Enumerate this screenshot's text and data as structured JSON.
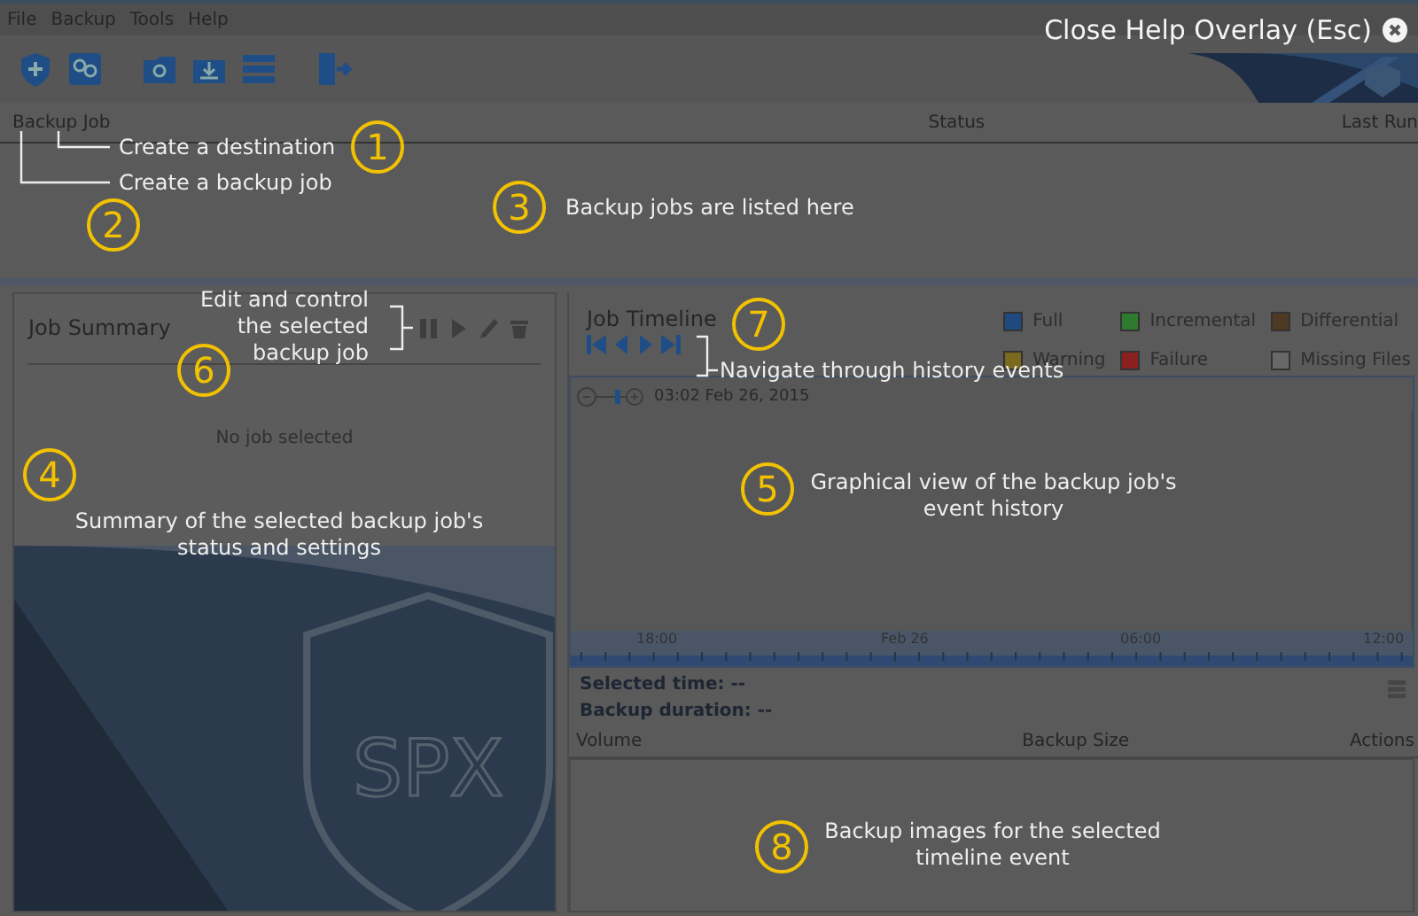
{
  "menu": [
    "File",
    "Backup",
    "Tools",
    "Help"
  ],
  "close_overlay": {
    "label": "Close Help Overlay (Esc)"
  },
  "jobs_table": {
    "columns": [
      "Backup Job",
      "Status",
      "Last Run"
    ]
  },
  "job_summary": {
    "title": "Job Summary",
    "empty_text": "No job selected",
    "logo_text": "SPX"
  },
  "job_timeline": {
    "title": "Job Timeline",
    "legend": [
      {
        "label": "Full",
        "color": "#1e4a80"
      },
      {
        "label": "Incremental",
        "color": "#2e7a2e"
      },
      {
        "label": "Differential",
        "color": "#4e3a22"
      },
      {
        "label": "Warning",
        "color": "#7a6a20"
      },
      {
        "label": "Failure",
        "color": "#8a2020"
      },
      {
        "label": "Missing Files",
        "color": "#686868"
      }
    ],
    "current_time": "03:02 Feb 26, 2015",
    "axis_labels": [
      "18:00",
      "Feb 26",
      "06:00",
      "12:00"
    ]
  },
  "details": [
    "Selected time: --",
    "Backup duration: --"
  ],
  "images_table": {
    "columns": [
      "Volume",
      "Backup Size",
      "Actions"
    ]
  },
  "annotations": [
    {
      "number": "1",
      "text": "Create a destination"
    },
    {
      "number": "2",
      "text": "Create a backup job"
    },
    {
      "number": "3",
      "text": "Backup jobs are listed here"
    },
    {
      "number": "4",
      "text": "Summary of the selected backup job's status and settings"
    },
    {
      "number": "5",
      "text": "Graphical view of the backup job's event history"
    },
    {
      "number": "6",
      "text": "Edit and control the selected backup job"
    },
    {
      "number": "7",
      "text": "Navigate through history events"
    },
    {
      "number": "8",
      "text": "Backup images for the selected timeline event"
    }
  ]
}
